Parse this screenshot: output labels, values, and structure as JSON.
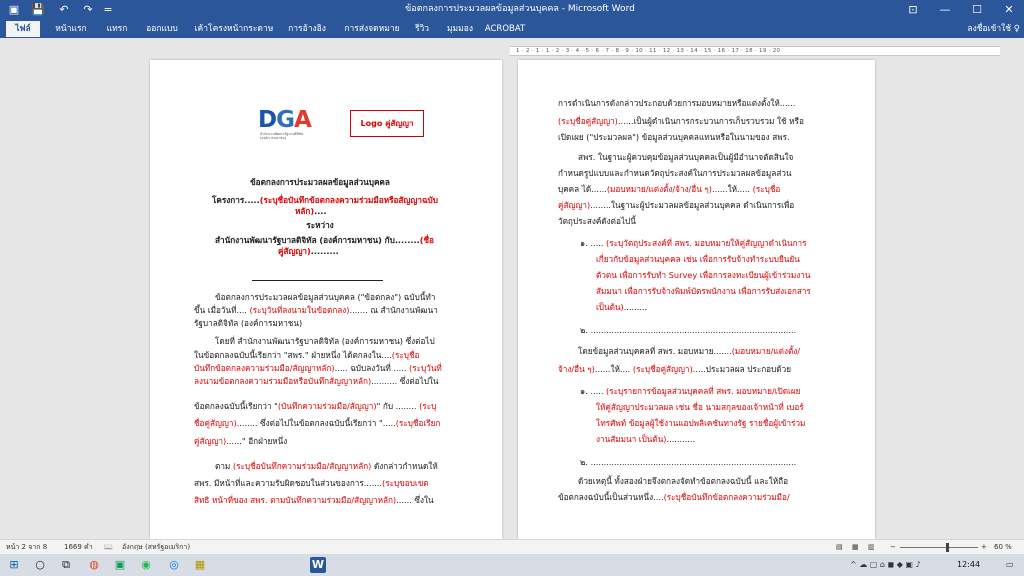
{
  "window": {
    "title": "ข้อตกลงการประมวลผลข้อมูลส่วนบุคคล - Microsoft Word",
    "controls": {
      "minimize": "—",
      "maximize": "☐",
      "close": "✕",
      "options": "⊡"
    }
  },
  "quick_access": {
    "save_icon": "💾",
    "undo_icon": "↶",
    "redo_icon": "↷",
    "customize_icon": "="
  },
  "ribbon": {
    "tabs": [
      "ไฟล์",
      "หน้าแรก",
      "แทรก",
      "ออกแบบ",
      "เค้าโครงหน้ากระดาษ",
      "การอ้างอิง",
      "การส่งจดหมาย",
      "รีวิว",
      "มุมมอง",
      "ACROBAT"
    ],
    "active_tab": "ไฟล์",
    "share": "ลงชื่อเข้าใช้ ♀"
  },
  "ruler": {
    "ticks": "1 · 2 · 1 · 1 · 2 · 3 · 4 · 5 · 6 · 7 · 8 · 9 · 10 · 11 · 12 · 13 · 14 · 15 · 16 · 17 · 18 · 19 · 20"
  },
  "page1": {
    "logo_text": "DGA",
    "logo_subtext": "สำนักงานพัฒนารัฐบาลดิจิทัล (องค์การมหาชน)",
    "partner_logo": "Logo คู่สัญญา",
    "lines": [
      {
        "t": "ข้อตกลงการประมวลผลข้อมูลส่วนบุคคล"
      },
      {
        "a": "โครงการ.....",
        "r": "(ระบุชื่อบันทึกข้อตกลงความร่วมมือหรือสัญญาฉบับ"
      },
      {
        "r": "หลัก)",
        "b": "...."
      },
      {
        "t": "ระหว่าง"
      },
      {
        "a": "สำนักงานพัฒนารัฐบาลดิจิทัล (องค์การมหาชน) กับ........",
        "r": "(ชื่อ"
      },
      {
        "r": "คู่สัญญา)",
        "b": "........."
      },
      {
        "a": "ข้อตกลงการประมวลผลข้อมูลส่วนบุคคล (\"ข้อตกลง\") ฉบับนี้ทำ"
      },
      {
        "a": "ขึ้น เมื่อวันที่.... ",
        "r": "(ระบุวันที่ลงนามในข้อตกลง)",
        "b": "....... ณ สำนักงานพัฒนา"
      },
      {
        "a": "รัฐบาลดิจิทัล (องค์การมหาชน)"
      },
      {
        "a": "โดยที่ สำนักงานพัฒนารัฐบาลดิจิทัล (องค์การมหาชน) ซึ่งต่อไป"
      },
      {
        "a": "ในข้อตกลงฉบับนี้เรียกว่า \"สพร.\" ฝ่ายหนึ่ง ได้ตกลงใน....",
        "r": "(ระบุชื่อ"
      },
      {
        "r": "บันทึกข้อตกลงความร่วมมือ/สัญญาหลัก)",
        "b": "..... ฉบับลงวันที่ ..... ",
        "r2": "(ระบุวันที่"
      },
      {
        "r": "ลงนามข้อตกลงความร่วมมือหรือบันทึกสัญญาหลัก)",
        "b": ".......... ซึ่งต่อไปใน"
      },
      {
        "a": "ข้อตกลงฉบับนี้เรียกว่า \"",
        "r": "(บันทึกความร่วมมือ/สัญญา)",
        "b": "\" กับ ........ ",
        "r2": "(ระบุ"
      },
      {
        "r": "ชื่อคู่สัญญา)",
        "b": "........ ซึ่งต่อไปในข้อตกลงฉบับนี้เรียกว่า \".....",
        "r2": "(ระบุชื่อเรียก"
      },
      {
        "r": "คู่สัญญา)",
        "b": "......\" อีกฝ่ายหนึ่ง"
      },
      {
        "a": "ตาม ",
        "r": "(ระบุชื่อบันทึกความร่วมมือ/สัญญาหลัก)",
        "b": " ดังกล่าวกำหนดให้"
      },
      {
        "a": "สพร. มีหน้าที่และความรับผิดชอบในส่วนของการ.......",
        "r": "(ระบุขอบเขต"
      },
      {
        "r": "สิทธิ หน้าที่ของ สพร. ตามบันทึกความร่วมมือ/สัญญาหลัก)",
        "b": "...... ซึ่งใน"
      }
    ]
  },
  "page2": {
    "lines": [
      {
        "a": "การดำเนินการดังกล่าวประกอบด้วยการมอบหมายหรือแต่งตั้งให้......"
      },
      {
        "r": "(ระบุชื่อคู่สัญญา)",
        "b": "......เป็นผู้ดำเนินการกระบวนการเก็บรวบรวม ใช้ หรือ"
      },
      {
        "a": "เปิดเผย (\"ประมวลผล\") ข้อมูลส่วนบุคคลแทนหรือในนามของ สพร."
      },
      {
        "a": "สพร. ในฐานะผู้ควบคุมข้อมูลส่วนบุคคลเป็นผู้มีอำนาจตัดสินใจ"
      },
      {
        "a": "กำหนดรูปแบบและกำหนดวัตถุประสงค์ในการประมวลผลข้อมูลส่วน"
      },
      {
        "a": "บุคคล ได้......",
        "r": "(มอบหมาย/แต่งตั้ง/จ้าง/อื่น ๆ)",
        "b": "......ให้..... ",
        "r2": "(ระบุชื่อ"
      },
      {
        "r": "คู่สัญญา)",
        "b": "........ในฐานะผู้ประมวลผลข้อมูลส่วนบุคคล ดำเนินการเพื่อ"
      },
      {
        "a": "วัตถุประสงค์ดังต่อไปนี้"
      },
      {
        "a": "๑. ..... ",
        "r": "(ระบุวัตถุประสงค์ที่ สพร. มอบหมายให้คู่สัญญาดำเนินการ"
      },
      {
        "r": "เกี่ยวกับข้อมูลส่วนบุคคล เช่น เพื่อการรับจ้างทำระบบยืนยัน"
      },
      {
        "r": "ตัวตน เพื่อการรับทำ Survey เพื่อการลงทะเบียนผู้เข้าร่วมงาน"
      },
      {
        "r": "สัมมนา เพื่อการรับจ้างพิมพ์บัตรพนักงาน เพื่อการรับส่งเอกสาร"
      },
      {
        "r": "เป็นต้น)",
        "b": "........."
      },
      {
        "a": "๒. ..............................................................................."
      },
      {
        "a": "โดยข้อมูลส่วนบุคคลที่ สพร. มอบหมาย.......",
        "r": "(มอบหมาย/แต่งตั้ง/"
      },
      {
        "r": "จ้าง/อื่น ๆ)",
        "b": "......ให้.... ",
        "r2": "(ระบุชื่อคู่สัญญา)",
        "b2": ".....ประมวลผล ประกอบด้วย"
      },
      {
        "a": "๑. ..... ",
        "r": "(ระบุรายการข้อมูลส่วนบุคคลที่ สพร. มอบหมาย/เปิดเผย"
      },
      {
        "r": "ให้คู่สัญญาประมวลผล เช่น ชื่อ นามสกุลของเจ้าหน้าที่ เบอร์"
      },
      {
        "r": "โทรศัพท์ ข้อมูลผู้ใช้งานแอปพลิเคชันทางรัฐ รายชื่อผู้เข้าร่วม"
      },
      {
        "r": "งานสัมมนา เป็นต้น)",
        "b": "..........."
      },
      {
        "a": "๒. ..............................................................................."
      },
      {
        "a": "ด้วยเหตุนี้ ทั้งสองฝ่ายจึงตกลงจัดทำข้อตกลงฉบับนี้ และให้ถือ"
      },
      {
        "a": "ข้อตกลงฉบับนี้เป็นส่วนหนึ่ง....",
        "r": "(ระบุชื่อบันทึกข้อตกลงความร่วมมือ/"
      }
    ]
  },
  "statusbar": {
    "page": "หน้า 2 จาก 8",
    "words": "1669 คำ",
    "proof_icon": "📖",
    "language": "อังกฤษ (สหรัฐอเมริกา)",
    "view_icons": [
      "▤",
      "▦",
      "▥"
    ],
    "zoom_out": "−",
    "zoom_in": "+",
    "zoom": "60 %"
  },
  "taskbar": {
    "time": "12:44",
    "icons": [
      "⊞",
      "○",
      "⧉",
      "◍",
      "▣",
      "◉",
      "◎",
      "▦",
      "W"
    ]
  }
}
